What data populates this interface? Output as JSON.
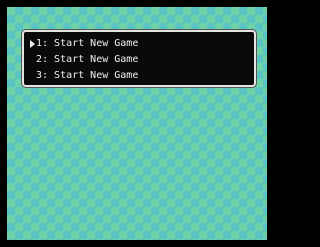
{
  "menu": {
    "items": [
      {
        "label": "1: Start New Game",
        "selected": true
      },
      {
        "label": "2: Start New Game",
        "selected": false
      },
      {
        "label": "3: Start New Game",
        "selected": false
      }
    ],
    "cursor_icon": "triangle-right-icon"
  },
  "colors": {
    "frame": "#000000",
    "checker_light": "#6fd2a6",
    "checker_dark": "#58c4c6",
    "window_bg": "#0a0a0a",
    "window_border": "#e4e4e4",
    "text": "#f0f0f0"
  }
}
